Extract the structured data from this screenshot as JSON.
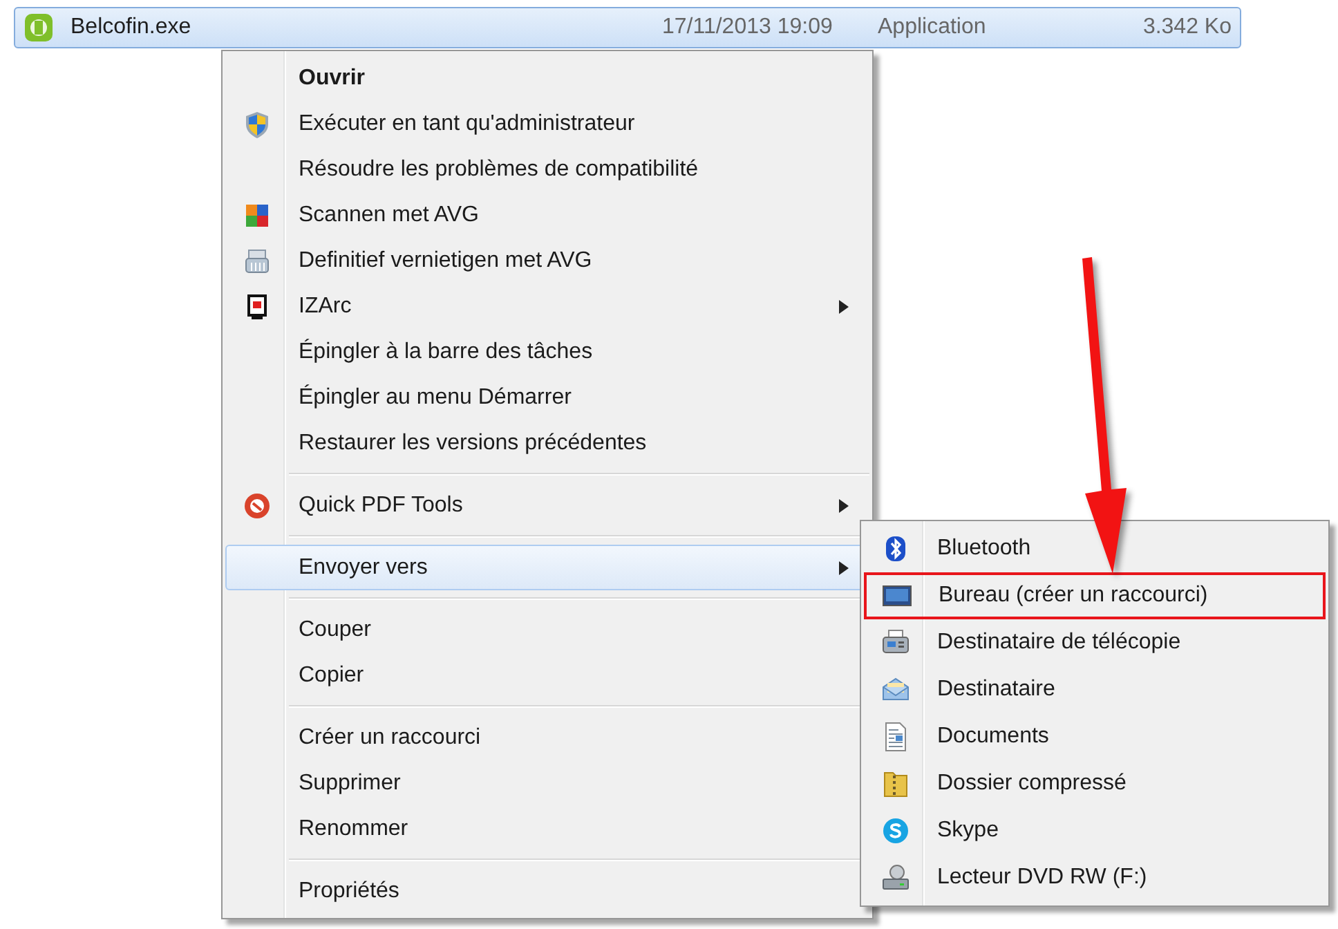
{
  "file_row": {
    "name": "Belcofin.exe",
    "date": "17/11/2013 19:09",
    "type": "Application",
    "size": "3.342 Ko",
    "selected": true
  },
  "context_menu": {
    "items": [
      {
        "kind": "item",
        "label": "Ouvrir",
        "bold": true,
        "has_submenu": false,
        "selected": false
      },
      {
        "kind": "item",
        "label": "Exécuter en tant qu'administrateur",
        "bold": false,
        "has_submenu": false,
        "selected": false
      },
      {
        "kind": "item",
        "label": "Résoudre les problèmes de compatibilité",
        "bold": false,
        "has_submenu": false,
        "selected": false
      },
      {
        "kind": "item",
        "label": "Scannen met AVG",
        "bold": false,
        "has_submenu": false,
        "selected": false
      },
      {
        "kind": "item",
        "label": "Definitief vernietigen met AVG",
        "bold": false,
        "has_submenu": false,
        "selected": false
      },
      {
        "kind": "item",
        "label": "IZArc",
        "bold": false,
        "has_submenu": true,
        "selected": false
      },
      {
        "kind": "item",
        "label": "Épingler à la barre des tâches",
        "bold": false,
        "has_submenu": false,
        "selected": false
      },
      {
        "kind": "item",
        "label": "Épingler au menu Démarrer",
        "bold": false,
        "has_submenu": false,
        "selected": false
      },
      {
        "kind": "item",
        "label": "Restaurer les versions précédentes",
        "bold": false,
        "has_submenu": false,
        "selected": false
      },
      {
        "kind": "separator"
      },
      {
        "kind": "item",
        "label": "Quick PDF Tools",
        "bold": false,
        "has_submenu": true,
        "selected": false
      },
      {
        "kind": "separator"
      },
      {
        "kind": "item",
        "label": "Envoyer vers",
        "bold": false,
        "has_submenu": true,
        "selected": true
      },
      {
        "kind": "separator"
      },
      {
        "kind": "item",
        "label": "Couper",
        "bold": false,
        "has_submenu": false,
        "selected": false
      },
      {
        "kind": "item",
        "label": "Copier",
        "bold": false,
        "has_submenu": false,
        "selected": false
      },
      {
        "kind": "separator"
      },
      {
        "kind": "item",
        "label": "Créer un raccourci",
        "bold": false,
        "has_submenu": false,
        "selected": false
      },
      {
        "kind": "item",
        "label": "Supprimer",
        "bold": false,
        "has_submenu": false,
        "selected": false
      },
      {
        "kind": "item",
        "label": "Renommer",
        "bold": false,
        "has_submenu": false,
        "selected": false
      },
      {
        "kind": "separator"
      },
      {
        "kind": "item",
        "label": "Propriétés",
        "bold": false,
        "has_submenu": false,
        "selected": false
      }
    ]
  },
  "send_to_menu": {
    "items": [
      {
        "label": "Bluetooth",
        "highlighted": false
      },
      {
        "label": "Bureau (créer un raccourci)",
        "highlighted": true
      },
      {
        "label": "Destinataire de télécopie",
        "highlighted": false
      },
      {
        "label": "Destinataire",
        "highlighted": false
      },
      {
        "label": "Documents",
        "highlighted": false
      },
      {
        "label": "Dossier compressé",
        "highlighted": false
      },
      {
        "label": "Skype",
        "highlighted": false
      },
      {
        "label": "Lecteur DVD RW (F:)",
        "highlighted": false
      }
    ]
  }
}
